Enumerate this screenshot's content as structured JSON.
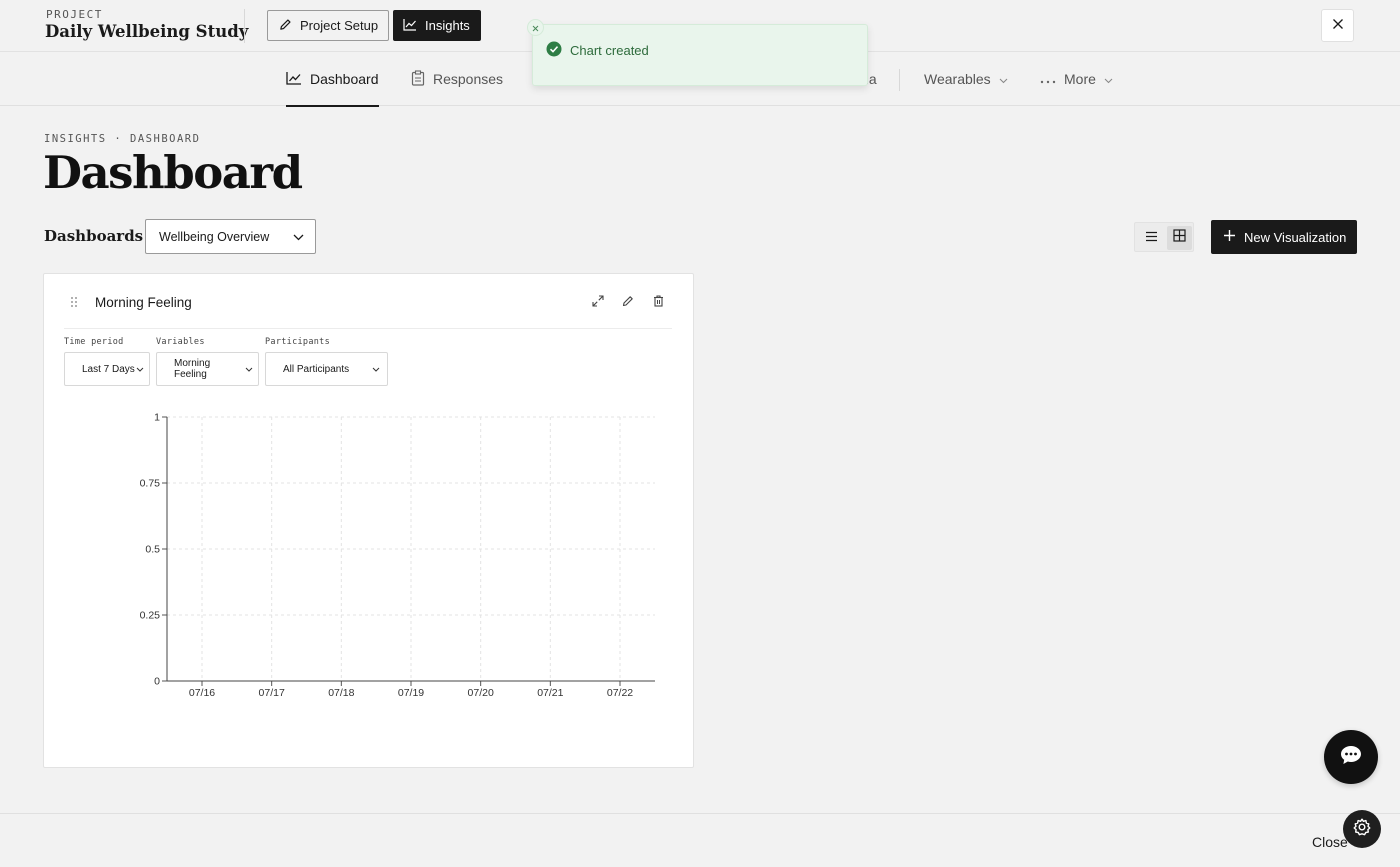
{
  "header": {
    "project_label": "PROJECT",
    "project_name": "Daily Wellbeing Study",
    "setup_label": "Project Setup",
    "insights_label": "Insights"
  },
  "nav": {
    "tabs": [
      {
        "label": "Dashboard",
        "icon": "line-chart-icon",
        "active": true
      },
      {
        "label": "Responses",
        "icon": "clipboard-icon",
        "active": false
      },
      {
        "label": "",
        "icon": "partial-icon",
        "active": false
      },
      {
        "label": "ula",
        "icon": "",
        "active": false
      },
      {
        "label": "Wearables",
        "icon": "chevron-down-icon",
        "active": false
      },
      {
        "label": "More",
        "icon": "ellipsis-icon",
        "active": false
      }
    ]
  },
  "toast": {
    "message": "Chart created",
    "color": "#2e6b3c"
  },
  "page": {
    "breadcrumb": "INSIGHTS · DASHBOARD",
    "title": "Dashboard",
    "dashboards_label": "Dashboards",
    "dashboard_selected": "Wellbeing Overview",
    "new_visualization_label": "New Visualization"
  },
  "card": {
    "title": "Morning Feeling",
    "filters": {
      "time_label": "Time period",
      "time_value": "Last 7 Days",
      "variables_label": "Variables",
      "variables_value": "Morning Feeling",
      "participants_label": "Participants",
      "participants_value": "All Participants"
    }
  },
  "chart_data": {
    "type": "line",
    "categories": [
      "07/16",
      "07/17",
      "07/18",
      "07/19",
      "07/20",
      "07/21",
      "07/22"
    ],
    "series": [],
    "yticks": [
      "0",
      "0.25",
      "0.5",
      "0.75",
      "1"
    ],
    "ylim": [
      0,
      1
    ],
    "grid": true
  },
  "footer": {
    "close_label": "Close"
  },
  "colors": {
    "accent": "#1a1a1a",
    "toast_bg": "#e9f5ec",
    "success": "#2e7d45"
  }
}
